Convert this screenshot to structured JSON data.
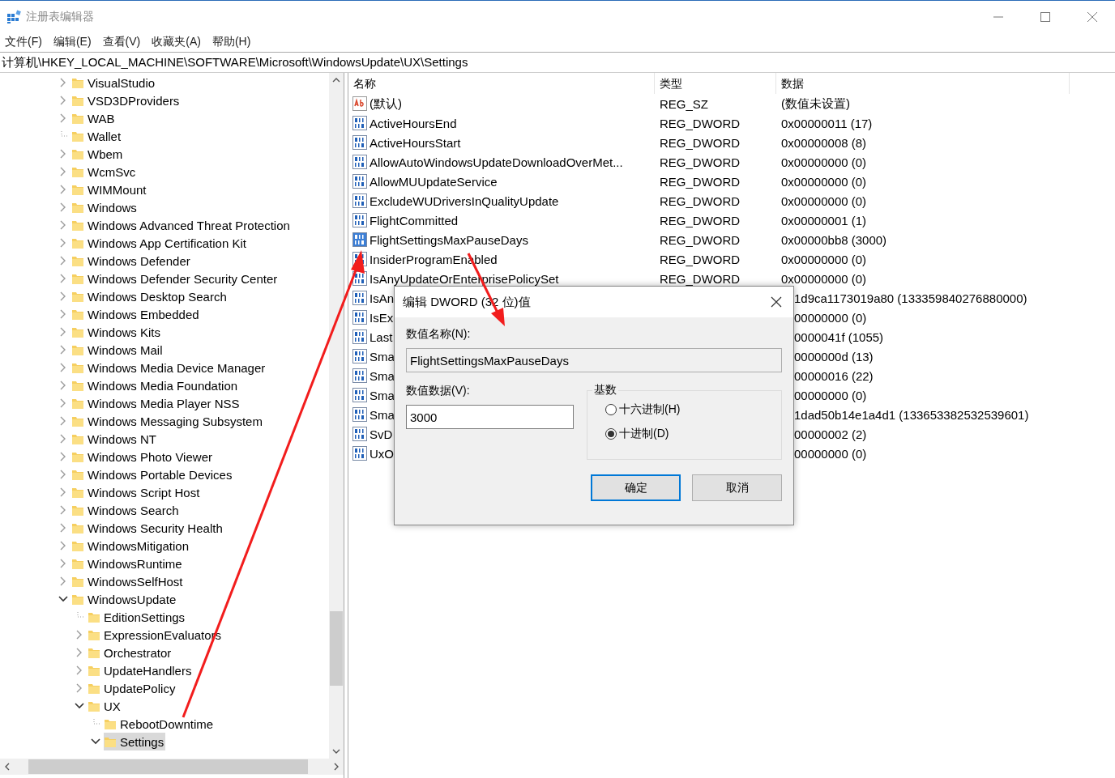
{
  "window": {
    "title": "注册表编辑器"
  },
  "menu": [
    "文件(F)",
    "编辑(E)",
    "查看(V)",
    "收藏夹(A)",
    "帮助(H)"
  ],
  "address": "计算机\\HKEY_LOCAL_MACHINE\\SOFTWARE\\Microsoft\\WindowsUpdate\\UX\\Settings",
  "tree": {
    "items": [
      {
        "label": "VisualStudio",
        "expandable": true,
        "expanded": false,
        "selected": false
      },
      {
        "label": "VSD3DProviders",
        "expandable": true,
        "expanded": false,
        "selected": false
      },
      {
        "label": "WAB",
        "expandable": true,
        "expanded": false,
        "selected": false
      },
      {
        "label": "Wallet",
        "expandable": false,
        "expanded": false,
        "selected": false
      },
      {
        "label": "Wbem",
        "expandable": true,
        "expanded": false,
        "selected": false
      },
      {
        "label": "WcmSvc",
        "expandable": true,
        "expanded": false,
        "selected": false
      },
      {
        "label": "WIMMount",
        "expandable": true,
        "expanded": false,
        "selected": false
      },
      {
        "label": "Windows",
        "expandable": true,
        "expanded": false,
        "selected": false
      },
      {
        "label": "Windows Advanced Threat Protection",
        "expandable": true,
        "expanded": false,
        "selected": false
      },
      {
        "label": "Windows App Certification Kit",
        "expandable": true,
        "expanded": false,
        "selected": false
      },
      {
        "label": "Windows Defender",
        "expandable": true,
        "expanded": false,
        "selected": false
      },
      {
        "label": "Windows Defender Security Center",
        "expandable": true,
        "expanded": false,
        "selected": false
      },
      {
        "label": "Windows Desktop Search",
        "expandable": true,
        "expanded": false,
        "selected": false
      },
      {
        "label": "Windows Embedded",
        "expandable": true,
        "expanded": false,
        "selected": false
      },
      {
        "label": "Windows Kits",
        "expandable": true,
        "expanded": false,
        "selected": false
      },
      {
        "label": "Windows Mail",
        "expandable": true,
        "expanded": false,
        "selected": false
      },
      {
        "label": "Windows Media Device Manager",
        "expandable": true,
        "expanded": false,
        "selected": false
      },
      {
        "label": "Windows Media Foundation",
        "expandable": true,
        "expanded": false,
        "selected": false
      },
      {
        "label": "Windows Media Player NSS",
        "expandable": true,
        "expanded": false,
        "selected": false
      },
      {
        "label": "Windows Messaging Subsystem",
        "expandable": true,
        "expanded": false,
        "selected": false
      },
      {
        "label": "Windows NT",
        "expandable": true,
        "expanded": false,
        "selected": false
      },
      {
        "label": "Windows Photo Viewer",
        "expandable": true,
        "expanded": false,
        "selected": false
      },
      {
        "label": "Windows Portable Devices",
        "expandable": true,
        "expanded": false,
        "selected": false
      },
      {
        "label": "Windows Script Host",
        "expandable": true,
        "expanded": false,
        "selected": false
      },
      {
        "label": "Windows Search",
        "expandable": true,
        "expanded": false,
        "selected": false
      },
      {
        "label": "Windows Security Health",
        "expandable": true,
        "expanded": false,
        "selected": false
      },
      {
        "label": "WindowsMitigation",
        "expandable": true,
        "expanded": false,
        "selected": false
      },
      {
        "label": "WindowsRuntime",
        "expandable": true,
        "expanded": false,
        "selected": false
      },
      {
        "label": "WindowsSelfHost",
        "expandable": true,
        "expanded": false,
        "selected": false
      },
      {
        "label": "WindowsUpdate",
        "expandable": true,
        "expanded": true,
        "selected": false,
        "children": [
          {
            "label": "EditionSettings",
            "expandable": false,
            "expanded": false,
            "selected": false
          },
          {
            "label": "ExpressionEvaluators",
            "expandable": true,
            "expanded": false,
            "selected": false
          },
          {
            "label": "Orchestrator",
            "expandable": true,
            "expanded": false,
            "selected": false
          },
          {
            "label": "UpdateHandlers",
            "expandable": true,
            "expanded": false,
            "selected": false
          },
          {
            "label": "UpdatePolicy",
            "expandable": true,
            "expanded": false,
            "selected": false
          },
          {
            "label": "UX",
            "expandable": true,
            "expanded": true,
            "selected": false,
            "children": [
              {
                "label": "RebootDowntime",
                "expandable": false,
                "expanded": false,
                "selected": false
              },
              {
                "label": "Settings",
                "expandable": true,
                "expanded": true,
                "selected": true
              }
            ]
          }
        ]
      }
    ]
  },
  "table": {
    "columns": [
      "名称",
      "类型",
      "数据"
    ],
    "rows": [
      {
        "kind": "sz",
        "name": "(默认)",
        "type": "REG_SZ",
        "data": "(数值未设置)",
        "selected": false
      },
      {
        "kind": "dword",
        "name": "ActiveHoursEnd",
        "type": "REG_DWORD",
        "data": "0x00000011 (17)",
        "selected": false
      },
      {
        "kind": "dword",
        "name": "ActiveHoursStart",
        "type": "REG_DWORD",
        "data": "0x00000008 (8)",
        "selected": false
      },
      {
        "kind": "dword",
        "name": "AllowAutoWindowsUpdateDownloadOverMet...",
        "type": "REG_DWORD",
        "data": "0x00000000 (0)",
        "selected": false
      },
      {
        "kind": "dword",
        "name": "AllowMUUpdateService",
        "type": "REG_DWORD",
        "data": "0x00000000 (0)",
        "selected": false
      },
      {
        "kind": "dword",
        "name": "ExcludeWUDriversInQualityUpdate",
        "type": "REG_DWORD",
        "data": "0x00000000 (0)",
        "selected": false
      },
      {
        "kind": "dword",
        "name": "FlightCommitted",
        "type": "REG_DWORD",
        "data": "0x00000001 (1)",
        "selected": false
      },
      {
        "kind": "dword",
        "name": "FlightSettingsMaxPauseDays",
        "type": "REG_DWORD",
        "data": "0x00000bb8 (3000)",
        "selected": true
      },
      {
        "kind": "dword",
        "name": "InsiderProgramEnabled",
        "type": "REG_DWORD",
        "data": "0x00000000 (0)",
        "selected": false
      },
      {
        "kind": "dword",
        "name": "IsAnyUpdateOrEnterprisePolicySet",
        "type": "REG_DWORD",
        "data": "0x00000000 (0)",
        "selected": false
      },
      {
        "kind": "dword",
        "name": "IsAn",
        "data": "1d9ca1173019a80 (133359840276880000)",
        "selected": false
      },
      {
        "kind": "dword",
        "name": "IsEx",
        "data": "00000000 (0)",
        "selected": false
      },
      {
        "kind": "dword",
        "name": "Last",
        "data": "0000041f (1055)",
        "selected": false
      },
      {
        "kind": "dword",
        "name": "Sma",
        "data": "0000000d (13)",
        "selected": false
      },
      {
        "kind": "dword",
        "name": "Sma",
        "data": "00000016 (22)",
        "selected": false
      },
      {
        "kind": "dword",
        "name": "Sma",
        "data": "00000000 (0)",
        "selected": false
      },
      {
        "kind": "dword",
        "name": "Sma",
        "data": "1dad50b14e1a4d1 (133653382532539601)",
        "selected": false
      },
      {
        "kind": "dword",
        "name": "SvD",
        "data": "00000002 (2)",
        "selected": false
      },
      {
        "kind": "dword",
        "name": "UxO",
        "data": "00000000 (0)",
        "selected": false
      }
    ]
  },
  "dialog": {
    "title": "编辑 DWORD (32 位)值",
    "name_label": "数值名称(N):",
    "name_value": "FlightSettingsMaxPauseDays",
    "data_label": "数值数据(V):",
    "data_value": "3000",
    "base_label": "基数",
    "base_options": [
      {
        "label": "十六进制(H)",
        "selected": false
      },
      {
        "label": "十进制(D)",
        "selected": true
      }
    ],
    "buttons": [
      {
        "label": "确定",
        "default": true
      },
      {
        "label": "取消",
        "default": false
      }
    ]
  }
}
